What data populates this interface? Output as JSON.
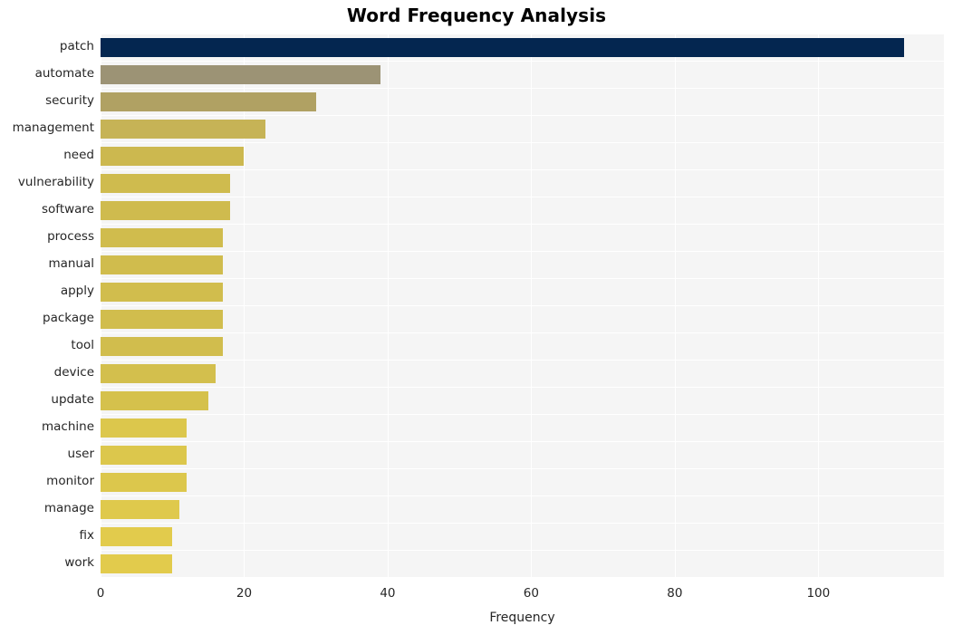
{
  "chart_data": {
    "type": "bar",
    "orientation": "horizontal",
    "title": "Word Frequency Analysis",
    "xlabel": "Frequency",
    "ylabel": "",
    "categories": [
      "patch",
      "automate",
      "security",
      "management",
      "need",
      "vulnerability",
      "software",
      "process",
      "manual",
      "apply",
      "package",
      "tool",
      "device",
      "update",
      "machine",
      "user",
      "monitor",
      "manage",
      "fix",
      "work"
    ],
    "values": [
      112,
      39,
      30,
      23,
      20,
      18,
      18,
      17,
      17,
      17,
      17,
      17,
      16,
      15,
      12,
      12,
      12,
      11,
      10,
      10
    ],
    "bar_colors": [
      "#042650",
      "#9c9375",
      "#b0a163",
      "#c6b356",
      "#ccb84f",
      "#cfbb4e",
      "#cfbb4e",
      "#d0bc4d",
      "#d0bc4d",
      "#d1bd4d",
      "#d1bd4d",
      "#d1bd4d",
      "#d3bf4d",
      "#d5c14c",
      "#dcc74c",
      "#dcc74c",
      "#dcc74c",
      "#dfc94c",
      "#e2cb4c",
      "#e2cb4c"
    ],
    "xticks": [
      0,
      20,
      40,
      60,
      80,
      100
    ],
    "xlim": [
      0,
      117.5
    ],
    "grid": true,
    "grid_color": "#ffffff",
    "plot_background": "#f5f5f5",
    "figure_background": "#ffffff",
    "legend": "none"
  }
}
